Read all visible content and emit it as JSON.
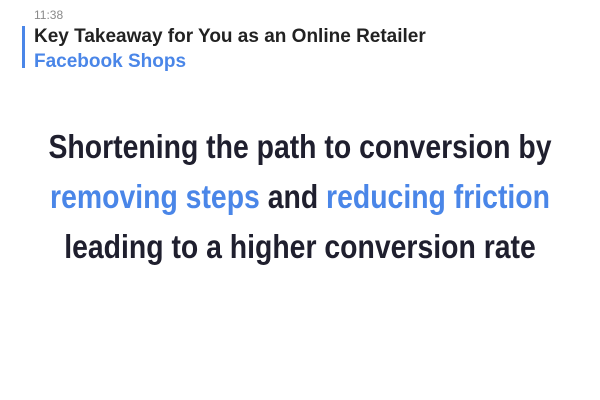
{
  "status": {
    "time": "11:38"
  },
  "header": {
    "title": "Key Takeaway for You as an Online Retailer",
    "subtitle": "Facebook Shops"
  },
  "headline": {
    "line1": "Shortening the path to conversion by",
    "line2_part1": "removing steps",
    "line2_part2": " and ",
    "line2_part3": "reducing friction",
    "line3": "leading to a higher conversion rate"
  },
  "colors": {
    "accent": "#4a86e8",
    "text_dark": "#1f1f2e",
    "title": "#222222",
    "timestamp": "#8a8a8a",
    "background": "#ffffff"
  }
}
